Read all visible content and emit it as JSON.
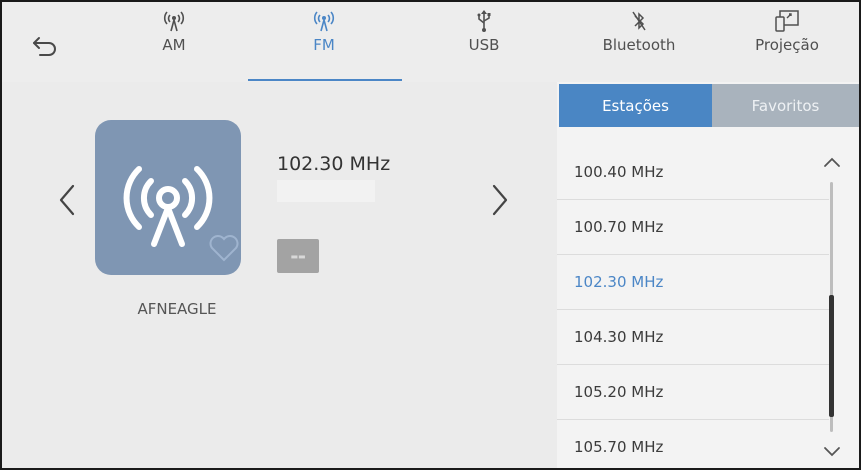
{
  "tabs": [
    {
      "label": "AM",
      "icon": "radio-antenna-icon",
      "active": false
    },
    {
      "label": "FM",
      "icon": "radio-antenna-icon",
      "active": true
    },
    {
      "label": "USB",
      "icon": "usb-icon",
      "active": false
    },
    {
      "label": "Bluetooth",
      "icon": "bluetooth-off-icon",
      "active": false
    },
    {
      "label": "Projeção",
      "icon": "phone-projection-icon",
      "active": false
    }
  ],
  "now_playing": {
    "frequency": "102.30 MHz",
    "station_name": "AFNEAGLE"
  },
  "list_tabs": {
    "stations": "Estações",
    "favorites": "Favoritos"
  },
  "stations": [
    {
      "frequency": "100.40 MHz",
      "selected": false
    },
    {
      "frequency": "100.70 MHz",
      "selected": false
    },
    {
      "frequency": "102.30 MHz",
      "selected": true
    },
    {
      "frequency": "104.30 MHz",
      "selected": false
    },
    {
      "frequency": "105.20 MHz",
      "selected": false
    },
    {
      "frequency": "105.70 MHz",
      "selected": false
    }
  ],
  "colors": {
    "accent": "#4b86c6",
    "art_background": "#7f96b3"
  }
}
